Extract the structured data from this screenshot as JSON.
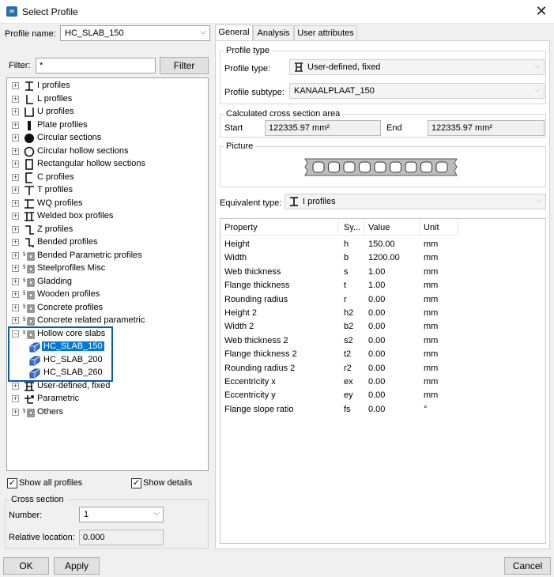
{
  "window": {
    "title": "Select Profile",
    "icon": "app-logo-icon"
  },
  "profile_name": {
    "label": "Profile name:",
    "value": "HC_SLAB_150"
  },
  "filter": {
    "label": "Filter:",
    "value": "*",
    "button": "Filter"
  },
  "tree": [
    {
      "label": "I profiles",
      "icon": "i-profile-icon",
      "expand": "+"
    },
    {
      "label": "L profiles",
      "icon": "l-profile-icon",
      "expand": "+"
    },
    {
      "label": "U profiles",
      "icon": "u-profile-icon",
      "expand": "+"
    },
    {
      "label": "Plate profiles",
      "icon": "plate-profile-icon",
      "expand": "+"
    },
    {
      "label": "Circular sections",
      "icon": "circle-icon",
      "expand": "+"
    },
    {
      "label": "Circular hollow sections",
      "icon": "circle-hollow-icon",
      "expand": "+"
    },
    {
      "label": "Rectangular hollow sections",
      "icon": "rect-hollow-icon",
      "expand": "+"
    },
    {
      "label": "C profiles",
      "icon": "c-profile-icon",
      "expand": "+"
    },
    {
      "label": "T profiles",
      "icon": "t-profile-icon",
      "expand": "+"
    },
    {
      "label": "WQ profiles",
      "icon": "wq-profile-icon",
      "expand": "+"
    },
    {
      "label": "Welded box profiles",
      "icon": "welded-box-icon",
      "expand": "+"
    },
    {
      "label": "Z profiles",
      "icon": "z-profile-icon",
      "expand": "+"
    },
    {
      "label": "Bended profiles",
      "icon": "bended-profile-icon",
      "expand": "+"
    },
    {
      "label": "Bended Parametric profiles",
      "icon": "parametric-icon",
      "expand": "+"
    },
    {
      "label": "Steelprofiles Misc",
      "icon": "parametric-icon",
      "expand": "+"
    },
    {
      "label": "Gladding",
      "icon": "parametric-icon",
      "expand": "+"
    },
    {
      "label": "Wooden profiles",
      "icon": "parametric-icon",
      "expand": "+"
    },
    {
      "label": "Concrete profiles",
      "icon": "parametric-icon",
      "expand": "+"
    },
    {
      "label": "Concrete related parametric",
      "icon": "parametric-icon",
      "expand": "+"
    },
    {
      "label": "Hollow core slabs",
      "icon": "parametric-icon",
      "expand": "−"
    },
    {
      "label": "HC_SLAB_150",
      "icon": "slab-icon",
      "child": true,
      "selected": true
    },
    {
      "label": "HC_SLAB_200",
      "icon": "slab-icon",
      "child": true
    },
    {
      "label": "HC_SLAB_260",
      "icon": "slab-icon",
      "child": true
    },
    {
      "label": "User-defined, fixed",
      "icon": "user-defined-icon",
      "expand": "+"
    },
    {
      "label": "Parametric",
      "icon": "parametric-node-icon",
      "expand": "+"
    },
    {
      "label": "Others",
      "icon": "parametric-icon",
      "expand": "+"
    }
  ],
  "show_all_profiles": {
    "label": "Show all profiles",
    "checked": true
  },
  "show_details": {
    "label": "Show details",
    "checked": true
  },
  "cross_section": {
    "title": "Cross section",
    "number_label": "Number:",
    "number_value": "1",
    "relative_label": "Relative location:",
    "relative_value": "0.000"
  },
  "tabs": [
    {
      "label": "General",
      "active": true
    },
    {
      "label": "Analysis"
    },
    {
      "label": "User attributes"
    }
  ],
  "profile_type": {
    "title": "Profile type",
    "type_label": "Profile type:",
    "type_value": "User-defined, fixed",
    "subtype_label": "Profile subtype:",
    "subtype_value": "KANAALPLAAT_150"
  },
  "area": {
    "title": "Calculated cross section area",
    "start_label": "Start",
    "start_value": "122335.97 mm²",
    "end_label": "End",
    "end_value": "122335.97 mm²"
  },
  "picture": {
    "title": "Picture",
    "holes": 9
  },
  "equivalent": {
    "label": "Equivalent type:",
    "value": "I profiles"
  },
  "properties": {
    "headers": [
      "Property",
      "Sy...",
      "Value",
      "Unit"
    ],
    "rows": [
      [
        "Height",
        "h",
        "150.00",
        "mm"
      ],
      [
        "Width",
        "b",
        "1200.00",
        "mm"
      ],
      [
        "Web thickness",
        "s",
        "1.00",
        "mm"
      ],
      [
        "Flange thickness",
        "t",
        "1.00",
        "mm"
      ],
      [
        "Rounding radius",
        "r",
        "0.00",
        "mm"
      ],
      [
        "Height 2",
        "h2",
        "0.00",
        "mm"
      ],
      [
        "Width 2",
        "b2",
        "0.00",
        "mm"
      ],
      [
        "Web thickness 2",
        "s2",
        "0.00",
        "mm"
      ],
      [
        "Flange thickness 2",
        "t2",
        "0.00",
        "mm"
      ],
      [
        "Rounding radius 2",
        "r2",
        "0.00",
        "mm"
      ],
      [
        "Eccentricity x",
        "ex",
        "0.00",
        "mm"
      ],
      [
        "Eccentricity y",
        "ey",
        "0.00",
        "mm"
      ],
      [
        "Flange slope ratio",
        "fs",
        "0.00",
        "°"
      ]
    ]
  },
  "buttons": {
    "ok": "OK",
    "apply": "Apply",
    "cancel": "Cancel"
  },
  "colors": {
    "selection": "#0078d7",
    "highlight_border": "#0b5aa8",
    "slab_icon": "#3a6fd8"
  }
}
